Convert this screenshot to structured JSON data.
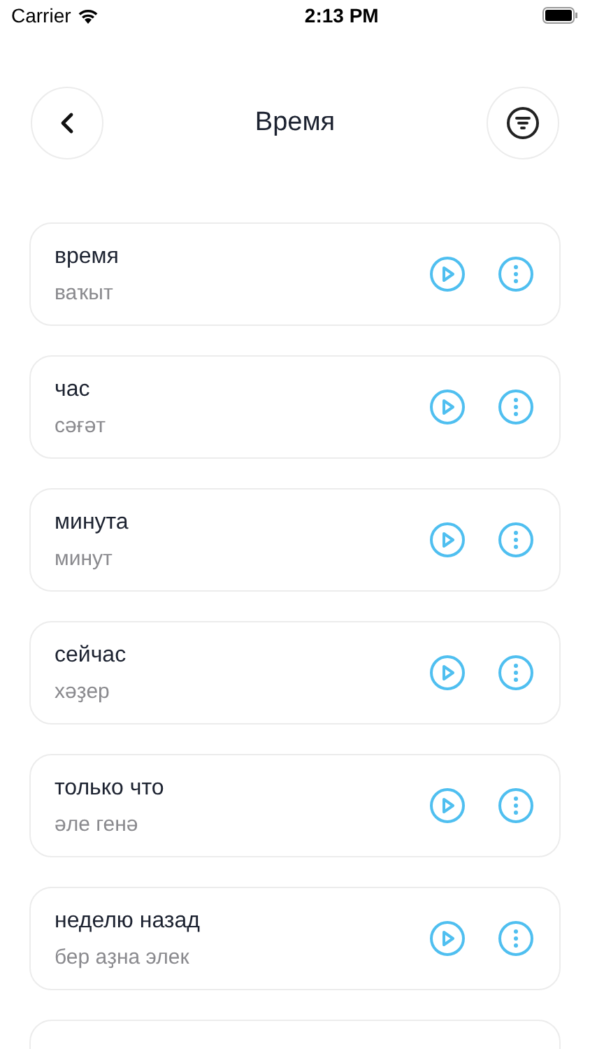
{
  "status_bar": {
    "carrier": "Carrier",
    "time": "2:13 PM"
  },
  "header": {
    "title": "Время"
  },
  "words": [
    {
      "word": "время",
      "translation": "ваҡыт"
    },
    {
      "word": "час",
      "translation": "сәғәт"
    },
    {
      "word": "минута",
      "translation": "минут"
    },
    {
      "word": "сейчас",
      "translation": "хәҙер"
    },
    {
      "word": "только что",
      "translation": "әле генә"
    },
    {
      "word": "неделю назад",
      "translation": "бер аҙна элек"
    }
  ]
}
